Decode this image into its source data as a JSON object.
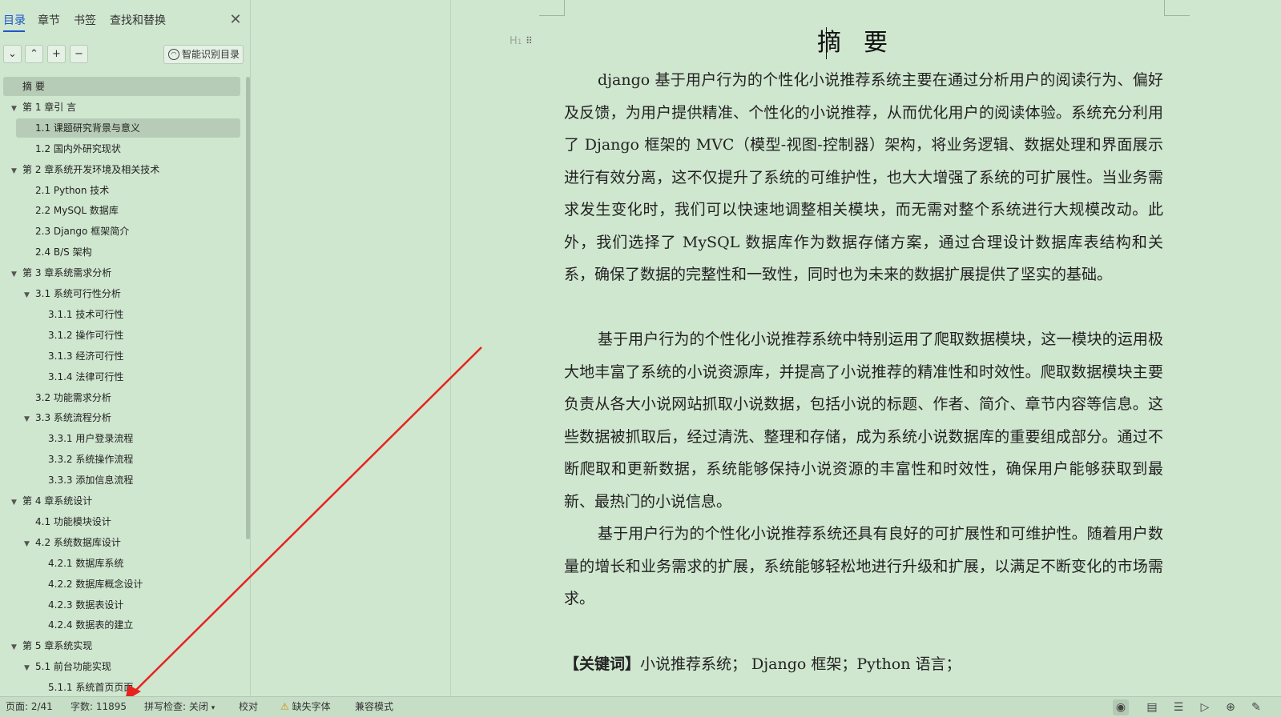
{
  "sidebar": {
    "tabs": [
      "目录",
      "章节",
      "书签",
      "查找和替换"
    ],
    "active_tab": 0,
    "close_icon": "close-icon",
    "toolbar": {
      "expand_icon": "chevron-down-icon",
      "collapse_icon": "chevron-up-icon",
      "add_icon": "plus-icon",
      "remove_icon": "minus-icon",
      "smart_button_label": "智能识别目录"
    },
    "toc": [
      {
        "text": "摘    要",
        "level": 0,
        "arrow": false,
        "selected": true
      },
      {
        "text": "第 1 章引  言",
        "level": 0,
        "arrow": true
      },
      {
        "text": "1.1 课题研究背景与意义",
        "level": 1,
        "arrow": false,
        "selected": true
      },
      {
        "text": "1.2 国内外研究现状",
        "level": 1,
        "arrow": false
      },
      {
        "text": "第 2 章系统开发环境及相关技术",
        "level": 0,
        "arrow": true
      },
      {
        "text": "2.1 Python 技术",
        "level": 1,
        "arrow": false
      },
      {
        "text": "2.2 MySQL 数据库",
        "level": 1,
        "arrow": false
      },
      {
        "text": "2.3 Django 框架简介",
        "level": 1,
        "arrow": false
      },
      {
        "text": "2.4 B/S 架构",
        "level": 1,
        "arrow": false
      },
      {
        "text": "第 3 章系统需求分析",
        "level": 0,
        "arrow": true
      },
      {
        "text": "3.1 系统可行性分析",
        "level": 1,
        "arrow": true
      },
      {
        "text": "3.1.1 技术可行性",
        "level": 2,
        "arrow": false
      },
      {
        "text": "3.1.2 操作可行性",
        "level": 2,
        "arrow": false
      },
      {
        "text": "3.1.3 经济可行性",
        "level": 2,
        "arrow": false
      },
      {
        "text": "3.1.4 法律可行性",
        "level": 2,
        "arrow": false
      },
      {
        "text": "3.2 功能需求分析",
        "level": 1,
        "arrow": false
      },
      {
        "text": "3.3 系统流程分析",
        "level": 1,
        "arrow": true
      },
      {
        "text": "3.3.1 用户登录流程",
        "level": 2,
        "arrow": false
      },
      {
        "text": "3.3.2 系统操作流程",
        "level": 2,
        "arrow": false
      },
      {
        "text": "3.3.3 添加信息流程",
        "level": 2,
        "arrow": false
      },
      {
        "text": "第 4 章系统设计",
        "level": 0,
        "arrow": true
      },
      {
        "text": "4.1 功能模块设计",
        "level": 1,
        "arrow": false
      },
      {
        "text": "4.2 系统数据库设计",
        "level": 1,
        "arrow": true
      },
      {
        "text": "4.2.1 数据库系统",
        "level": 2,
        "arrow": false
      },
      {
        "text": "4.2.2 数据库概念设计",
        "level": 2,
        "arrow": false
      },
      {
        "text": "4.2.3 数据表设计",
        "level": 2,
        "arrow": false
      },
      {
        "text": "4.2.4 数据表的建立",
        "level": 2,
        "arrow": false
      },
      {
        "text": "第 5 章系统实现",
        "level": 0,
        "arrow": true
      },
      {
        "text": "5.1 前台功能实现",
        "level": 1,
        "arrow": true
      },
      {
        "text": "5.1.1 系统首页页面",
        "level": 2,
        "arrow": false
      }
    ]
  },
  "document": {
    "heading_marker": "H",
    "title": "摘要",
    "paragraphs": [
      "django 基于用户行为的个性化小说推荐系统主要在通过分析用户的阅读行为、偏好及反馈，为用户提供精准、个性化的小说推荐，从而优化用户的阅读体验。系统充分利用了 Django 框架的 MVC（模型-视图-控制器）架构，将业务逻辑、数据处理和界面展示进行有效分离，这不仅提升了系统的可维护性，也大大增强了系统的可扩展性。当业务需求发生变化时，我们可以快速地调整相关模块，而无需对整个系统进行大规模改动。此外，我们选择了 MySQL 数据库作为数据存储方案，通过合理设计数据库表结构和关系，确保了数据的完整性和一致性，同时也为未来的数据扩展提供了坚实的基础。",
      "基于用户行为的个性化小说推荐系统中特别运用了爬取数据模块，这一模块的运用极大地丰富了系统的小说资源库，并提高了小说推荐的精准性和时效性。爬取数据模块主要负责从各大小说网站抓取小说数据，包括小说的标题、作者、简介、章节内容等信息。这些数据被抓取后，经过清洗、整理和存储，成为系统小说数据库的重要组成部分。通过不断爬取和更新数据，系统能够保持小说资源的丰富性和时效性，确保用户能够获取到最新、最热门的小说信息。",
      "基于用户行为的个性化小说推荐系统还具有良好的可扩展性和可维护性。随着用户数量的增长和业务需求的扩展，系统能够轻松地进行升级和扩展，以满足不断变化的市场需求。"
    ],
    "keywords_label": "【关键词】",
    "keywords_text": "小说推荐系统；  Django 框架；Python 语言；"
  },
  "annotation": {
    "arrow_color": "#e8221f"
  },
  "statusbar": {
    "page": "页面: 2/41",
    "words": "字数: 11895",
    "spellcheck": "拼写检查: 关闭",
    "proofread": "校对",
    "missing_fonts": "缺失字体",
    "compat_mode": "兼容模式",
    "warn_icon": "warning-icon",
    "right_icons": [
      "eye-icon",
      "page-view-icon",
      "outline-view-icon",
      "play-icon",
      "globe-icon",
      "pen-icon"
    ]
  }
}
